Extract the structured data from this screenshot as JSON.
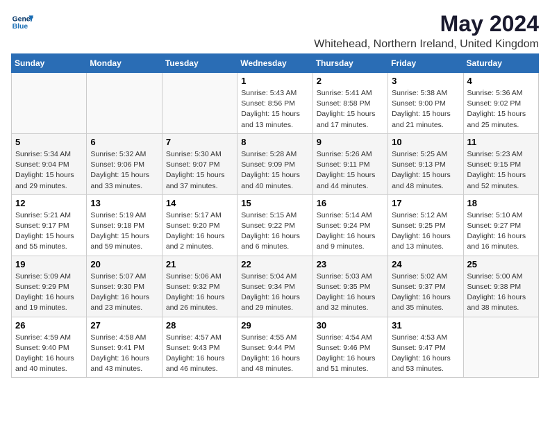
{
  "header": {
    "logo_line1": "General",
    "logo_line2": "Blue",
    "main_title": "May 2024",
    "subtitle": "Whitehead, Northern Ireland, United Kingdom"
  },
  "days_of_week": [
    "Sunday",
    "Monday",
    "Tuesday",
    "Wednesday",
    "Thursday",
    "Friday",
    "Saturday"
  ],
  "weeks": [
    [
      {
        "day": "",
        "info": ""
      },
      {
        "day": "",
        "info": ""
      },
      {
        "day": "",
        "info": ""
      },
      {
        "day": "1",
        "info": "Sunrise: 5:43 AM\nSunset: 8:56 PM\nDaylight: 15 hours\nand 13 minutes."
      },
      {
        "day": "2",
        "info": "Sunrise: 5:41 AM\nSunset: 8:58 PM\nDaylight: 15 hours\nand 17 minutes."
      },
      {
        "day": "3",
        "info": "Sunrise: 5:38 AM\nSunset: 9:00 PM\nDaylight: 15 hours\nand 21 minutes."
      },
      {
        "day": "4",
        "info": "Sunrise: 5:36 AM\nSunset: 9:02 PM\nDaylight: 15 hours\nand 25 minutes."
      }
    ],
    [
      {
        "day": "5",
        "info": "Sunrise: 5:34 AM\nSunset: 9:04 PM\nDaylight: 15 hours\nand 29 minutes."
      },
      {
        "day": "6",
        "info": "Sunrise: 5:32 AM\nSunset: 9:06 PM\nDaylight: 15 hours\nand 33 minutes."
      },
      {
        "day": "7",
        "info": "Sunrise: 5:30 AM\nSunset: 9:07 PM\nDaylight: 15 hours\nand 37 minutes."
      },
      {
        "day": "8",
        "info": "Sunrise: 5:28 AM\nSunset: 9:09 PM\nDaylight: 15 hours\nand 40 minutes."
      },
      {
        "day": "9",
        "info": "Sunrise: 5:26 AM\nSunset: 9:11 PM\nDaylight: 15 hours\nand 44 minutes."
      },
      {
        "day": "10",
        "info": "Sunrise: 5:25 AM\nSunset: 9:13 PM\nDaylight: 15 hours\nand 48 minutes."
      },
      {
        "day": "11",
        "info": "Sunrise: 5:23 AM\nSunset: 9:15 PM\nDaylight: 15 hours\nand 52 minutes."
      }
    ],
    [
      {
        "day": "12",
        "info": "Sunrise: 5:21 AM\nSunset: 9:17 PM\nDaylight: 15 hours\nand 55 minutes."
      },
      {
        "day": "13",
        "info": "Sunrise: 5:19 AM\nSunset: 9:18 PM\nDaylight: 15 hours\nand 59 minutes."
      },
      {
        "day": "14",
        "info": "Sunrise: 5:17 AM\nSunset: 9:20 PM\nDaylight: 16 hours\nand 2 minutes."
      },
      {
        "day": "15",
        "info": "Sunrise: 5:15 AM\nSunset: 9:22 PM\nDaylight: 16 hours\nand 6 minutes."
      },
      {
        "day": "16",
        "info": "Sunrise: 5:14 AM\nSunset: 9:24 PM\nDaylight: 16 hours\nand 9 minutes."
      },
      {
        "day": "17",
        "info": "Sunrise: 5:12 AM\nSunset: 9:25 PM\nDaylight: 16 hours\nand 13 minutes."
      },
      {
        "day": "18",
        "info": "Sunrise: 5:10 AM\nSunset: 9:27 PM\nDaylight: 16 hours\nand 16 minutes."
      }
    ],
    [
      {
        "day": "19",
        "info": "Sunrise: 5:09 AM\nSunset: 9:29 PM\nDaylight: 16 hours\nand 19 minutes."
      },
      {
        "day": "20",
        "info": "Sunrise: 5:07 AM\nSunset: 9:30 PM\nDaylight: 16 hours\nand 23 minutes."
      },
      {
        "day": "21",
        "info": "Sunrise: 5:06 AM\nSunset: 9:32 PM\nDaylight: 16 hours\nand 26 minutes."
      },
      {
        "day": "22",
        "info": "Sunrise: 5:04 AM\nSunset: 9:34 PM\nDaylight: 16 hours\nand 29 minutes."
      },
      {
        "day": "23",
        "info": "Sunrise: 5:03 AM\nSunset: 9:35 PM\nDaylight: 16 hours\nand 32 minutes."
      },
      {
        "day": "24",
        "info": "Sunrise: 5:02 AM\nSunset: 9:37 PM\nDaylight: 16 hours\nand 35 minutes."
      },
      {
        "day": "25",
        "info": "Sunrise: 5:00 AM\nSunset: 9:38 PM\nDaylight: 16 hours\nand 38 minutes."
      }
    ],
    [
      {
        "day": "26",
        "info": "Sunrise: 4:59 AM\nSunset: 9:40 PM\nDaylight: 16 hours\nand 40 minutes."
      },
      {
        "day": "27",
        "info": "Sunrise: 4:58 AM\nSunset: 9:41 PM\nDaylight: 16 hours\nand 43 minutes."
      },
      {
        "day": "28",
        "info": "Sunrise: 4:57 AM\nSunset: 9:43 PM\nDaylight: 16 hours\nand 46 minutes."
      },
      {
        "day": "29",
        "info": "Sunrise: 4:55 AM\nSunset: 9:44 PM\nDaylight: 16 hours\nand 48 minutes."
      },
      {
        "day": "30",
        "info": "Sunrise: 4:54 AM\nSunset: 9:46 PM\nDaylight: 16 hours\nand 51 minutes."
      },
      {
        "day": "31",
        "info": "Sunrise: 4:53 AM\nSunset: 9:47 PM\nDaylight: 16 hours\nand 53 minutes."
      },
      {
        "day": "",
        "info": ""
      }
    ]
  ]
}
